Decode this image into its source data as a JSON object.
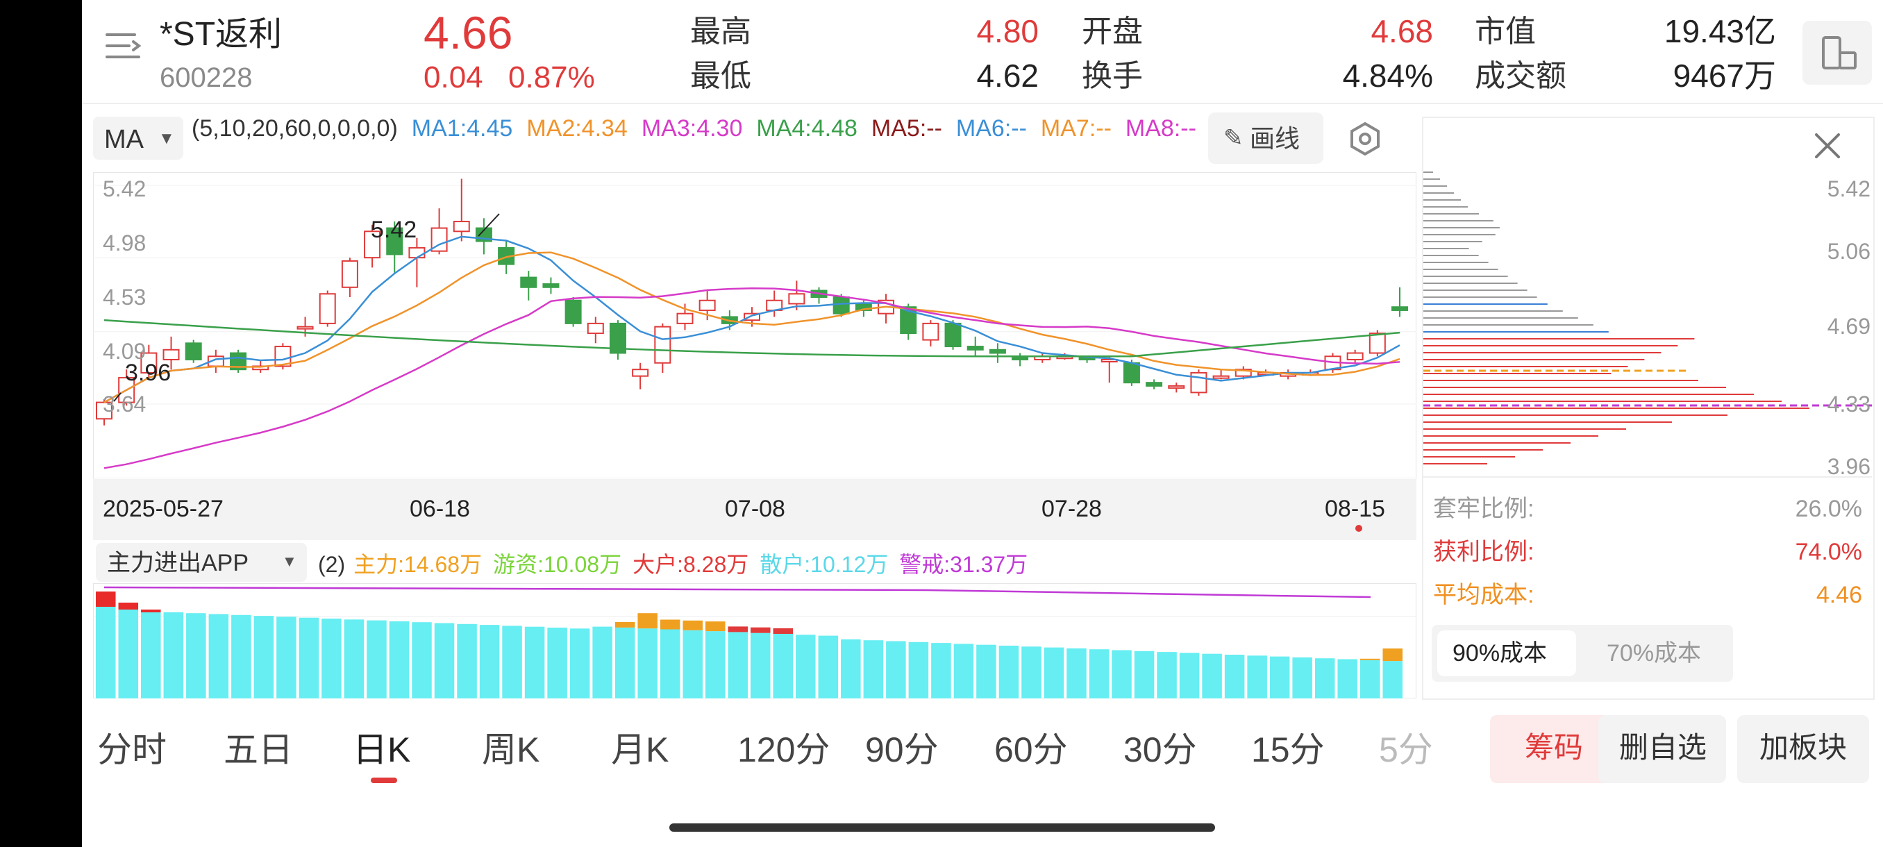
{
  "header": {
    "name": "*ST返利",
    "code": "600228",
    "price": "4.66",
    "change": "0.04",
    "change_pct": "0.87%",
    "high_label": "最高",
    "high": "4.80",
    "low_label": "最低",
    "low": "4.62",
    "open_label": "开盘",
    "open": "4.68",
    "turnover_label": "换手",
    "turnover": "4.84%",
    "mktcap_label": "市值",
    "mktcap": "19.43亿",
    "amount_label": "成交额",
    "amount": "9467万"
  },
  "ma_bar": {
    "selector": "MA",
    "params": "(5,10,20,60,0,0,0,0)",
    "items": [
      {
        "label": "MA1:4.45",
        "color": "#3a8fd6"
      },
      {
        "label": "MA2:4.34",
        "color": "#f0932b"
      },
      {
        "label": "MA3:4.30",
        "color": "#d63ac8"
      },
      {
        "label": "MA4:4.48",
        "color": "#3aa04a"
      },
      {
        "label": "MA5:--",
        "color": "#8b1a1a"
      },
      {
        "label": "MA6:--",
        "color": "#3a8fd6"
      },
      {
        "label": "MA7:--",
        "color": "#f0932b"
      },
      {
        "label": "MA8:--",
        "color": "#d63ac8"
      }
    ],
    "draw_button": "画线"
  },
  "price_axis": [
    "5.42",
    "4.98",
    "4.53",
    "4.09",
    "3.64"
  ],
  "annotations": {
    "high": "5.42",
    "low": "3.96"
  },
  "date_axis": [
    "2025-05-27",
    "06-18",
    "07-08",
    "07-28",
    "08-15"
  ],
  "indicator": {
    "selector": "主力进出APP",
    "param": "(2)",
    "items": [
      {
        "label": "主力:14.68万",
        "color": "#f0a020"
      },
      {
        "label": "游资:10.08万",
        "color": "#7ad43a"
      },
      {
        "label": "大户:8.28万",
        "color": "#e03a3a"
      },
      {
        "label": "散户:10.12万",
        "color": "#5ad8e8"
      },
      {
        "label": "警戒:31.37万",
        "color": "#c03ad6"
      }
    ]
  },
  "chip_panel": {
    "axis": [
      "5.42",
      "5.06",
      "4.69",
      "4.33",
      "3.96"
    ],
    "trapped_label": "套牢比例:",
    "trapped": "26.0%",
    "profit_label": "获利比例:",
    "profit": "74.0%",
    "avg_label": "平均成本:",
    "avg": "4.46",
    "tab1": "90%成本",
    "tab2": "70%成本"
  },
  "tabs": [
    "分时",
    "五日",
    "日K",
    "周K",
    "月K",
    "120分",
    "90分",
    "60分",
    "30分",
    "15分",
    "5分"
  ],
  "active_tab": "日K",
  "bottom_buttons": {
    "chip": "筹码",
    "remove": "删自选",
    "add": "加板块"
  },
  "colors": {
    "up": "#e03a3a",
    "down": "#3aa04a",
    "accent": "#e03a3a"
  }
}
